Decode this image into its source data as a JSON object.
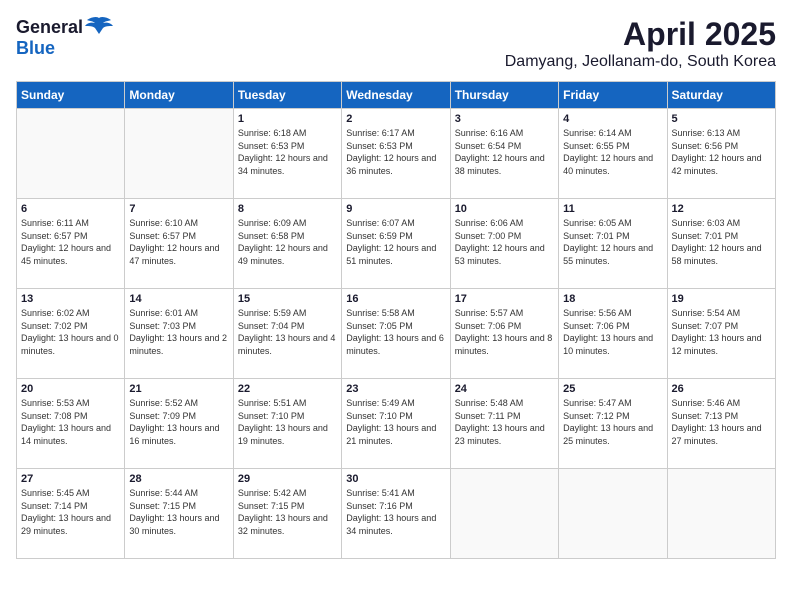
{
  "header": {
    "logo_general": "General",
    "logo_blue": "Blue",
    "month_title": "April 2025",
    "subtitle": "Damyang, Jeollanam-do, South Korea"
  },
  "days_of_week": [
    "Sunday",
    "Monday",
    "Tuesday",
    "Wednesday",
    "Thursday",
    "Friday",
    "Saturday"
  ],
  "weeks": [
    [
      {
        "day": "",
        "info": ""
      },
      {
        "day": "",
        "info": ""
      },
      {
        "day": "1",
        "info": "Sunrise: 6:18 AM\nSunset: 6:53 PM\nDaylight: 12 hours and 34 minutes."
      },
      {
        "day": "2",
        "info": "Sunrise: 6:17 AM\nSunset: 6:53 PM\nDaylight: 12 hours and 36 minutes."
      },
      {
        "day": "3",
        "info": "Sunrise: 6:16 AM\nSunset: 6:54 PM\nDaylight: 12 hours and 38 minutes."
      },
      {
        "day": "4",
        "info": "Sunrise: 6:14 AM\nSunset: 6:55 PM\nDaylight: 12 hours and 40 minutes."
      },
      {
        "day": "5",
        "info": "Sunrise: 6:13 AM\nSunset: 6:56 PM\nDaylight: 12 hours and 42 minutes."
      }
    ],
    [
      {
        "day": "6",
        "info": "Sunrise: 6:11 AM\nSunset: 6:57 PM\nDaylight: 12 hours and 45 minutes."
      },
      {
        "day": "7",
        "info": "Sunrise: 6:10 AM\nSunset: 6:57 PM\nDaylight: 12 hours and 47 minutes."
      },
      {
        "day": "8",
        "info": "Sunrise: 6:09 AM\nSunset: 6:58 PM\nDaylight: 12 hours and 49 minutes."
      },
      {
        "day": "9",
        "info": "Sunrise: 6:07 AM\nSunset: 6:59 PM\nDaylight: 12 hours and 51 minutes."
      },
      {
        "day": "10",
        "info": "Sunrise: 6:06 AM\nSunset: 7:00 PM\nDaylight: 12 hours and 53 minutes."
      },
      {
        "day": "11",
        "info": "Sunrise: 6:05 AM\nSunset: 7:01 PM\nDaylight: 12 hours and 55 minutes."
      },
      {
        "day": "12",
        "info": "Sunrise: 6:03 AM\nSunset: 7:01 PM\nDaylight: 12 hours and 58 minutes."
      }
    ],
    [
      {
        "day": "13",
        "info": "Sunrise: 6:02 AM\nSunset: 7:02 PM\nDaylight: 13 hours and 0 minutes."
      },
      {
        "day": "14",
        "info": "Sunrise: 6:01 AM\nSunset: 7:03 PM\nDaylight: 13 hours and 2 minutes."
      },
      {
        "day": "15",
        "info": "Sunrise: 5:59 AM\nSunset: 7:04 PM\nDaylight: 13 hours and 4 minutes."
      },
      {
        "day": "16",
        "info": "Sunrise: 5:58 AM\nSunset: 7:05 PM\nDaylight: 13 hours and 6 minutes."
      },
      {
        "day": "17",
        "info": "Sunrise: 5:57 AM\nSunset: 7:06 PM\nDaylight: 13 hours and 8 minutes."
      },
      {
        "day": "18",
        "info": "Sunrise: 5:56 AM\nSunset: 7:06 PM\nDaylight: 13 hours and 10 minutes."
      },
      {
        "day": "19",
        "info": "Sunrise: 5:54 AM\nSunset: 7:07 PM\nDaylight: 13 hours and 12 minutes."
      }
    ],
    [
      {
        "day": "20",
        "info": "Sunrise: 5:53 AM\nSunset: 7:08 PM\nDaylight: 13 hours and 14 minutes."
      },
      {
        "day": "21",
        "info": "Sunrise: 5:52 AM\nSunset: 7:09 PM\nDaylight: 13 hours and 16 minutes."
      },
      {
        "day": "22",
        "info": "Sunrise: 5:51 AM\nSunset: 7:10 PM\nDaylight: 13 hours and 19 minutes."
      },
      {
        "day": "23",
        "info": "Sunrise: 5:49 AM\nSunset: 7:10 PM\nDaylight: 13 hours and 21 minutes."
      },
      {
        "day": "24",
        "info": "Sunrise: 5:48 AM\nSunset: 7:11 PM\nDaylight: 13 hours and 23 minutes."
      },
      {
        "day": "25",
        "info": "Sunrise: 5:47 AM\nSunset: 7:12 PM\nDaylight: 13 hours and 25 minutes."
      },
      {
        "day": "26",
        "info": "Sunrise: 5:46 AM\nSunset: 7:13 PM\nDaylight: 13 hours and 27 minutes."
      }
    ],
    [
      {
        "day": "27",
        "info": "Sunrise: 5:45 AM\nSunset: 7:14 PM\nDaylight: 13 hours and 29 minutes."
      },
      {
        "day": "28",
        "info": "Sunrise: 5:44 AM\nSunset: 7:15 PM\nDaylight: 13 hours and 30 minutes."
      },
      {
        "day": "29",
        "info": "Sunrise: 5:42 AM\nSunset: 7:15 PM\nDaylight: 13 hours and 32 minutes."
      },
      {
        "day": "30",
        "info": "Sunrise: 5:41 AM\nSunset: 7:16 PM\nDaylight: 13 hours and 34 minutes."
      },
      {
        "day": "",
        "info": ""
      },
      {
        "day": "",
        "info": ""
      },
      {
        "day": "",
        "info": ""
      }
    ]
  ]
}
